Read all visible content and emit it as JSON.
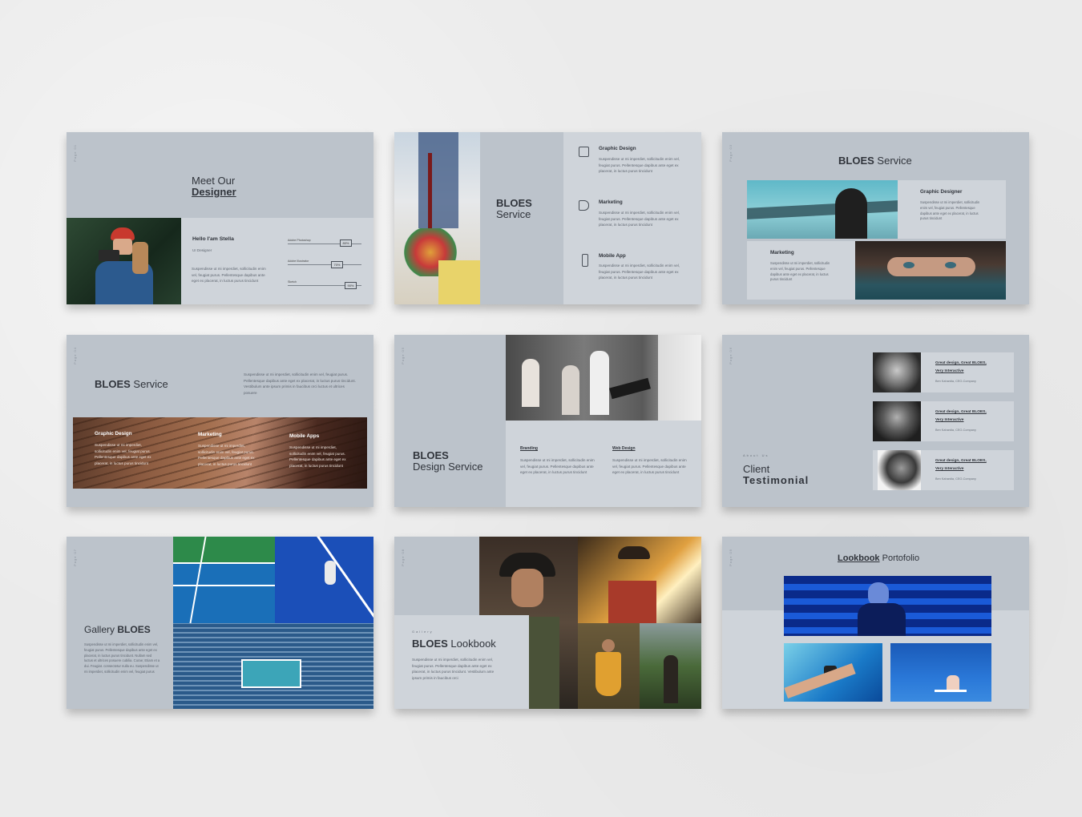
{
  "slides": {
    "s1": {
      "title_a": "Meet Our",
      "title_b": "Designer",
      "name": "Hello I'am Stella",
      "role": "UI Designer",
      "body": "Suspendisse ut mi imperdiet, sollicitudin enim vel, feugiat purus. Pellentesque dapibus ante eget ex placerat, in luctus purus tincidunt",
      "skills": [
        {
          "label": "Adobe Photoshop",
          "pct": "80%",
          "value": 0.8
        },
        {
          "label": "Adobe Illustrator",
          "pct": "70%",
          "value": 0.7
        },
        {
          "label": "Sketch",
          "pct": "90%",
          "value": 0.9
        }
      ]
    },
    "s2": {
      "title_a": "BLOES",
      "title_b": "Service",
      "items": [
        {
          "icon": "pencil-icon",
          "title": "Graphic Design"
        },
        {
          "icon": "megaphone-icon",
          "title": "Marketing"
        },
        {
          "icon": "phone-icon",
          "title": "Mobile App"
        }
      ],
      "body": "Suspendisse ut mi imperdiet, sollicitudin enim vel, feugiat purus. Pellentesque dapibus ante eget ex placerat, in luctus purus tincidunt"
    },
    "s3": {
      "title_a": "BLOES",
      "title_b": "Service",
      "c1": "Graphic Designer",
      "c2": "Marketing",
      "body": "Suspendisse ut mi imperdiet, sollicitudin enim vel, feugiat purus. Pellentesque dapibus ante eget ex placerat, in luctus purus tincidunt"
    },
    "s4": {
      "title_a": "BLOES",
      "title_b": "Service",
      "intro": "Suspendisse ut mi imperdiet, sollicitudin enim vel, feugiat purus. Pellentesque dapibus ante eget ex placerat, in luctus purus tincidunt. Vestibulum ante ipsum primis in faucibus orci luctus et ultrices posuere",
      "cols": [
        "Graphic Design",
        "Marketing",
        "Mobile Apps"
      ],
      "body": "Suspendisse ut mi imperdiet, sollicitudin enim vel, feugiat purus. Pellentesque dapibus ante eget ex placerat, in luctus purus tincidunt"
    },
    "s5": {
      "title_a": "BLOES",
      "title_b": "Design Service",
      "cols": [
        "Branding",
        "Web Design"
      ],
      "body": "Suspendisse ut mi imperdiet, sollicitudin enim vel, feugiat purus. Pellentesque dapibus ante eget ex placerat, in luctus purus tincidunt"
    },
    "s6": {
      "kicker": "About Us",
      "title_a": "Client",
      "title_b": "Testimonial",
      "quote_a": "Great design, Great BLOES,",
      "quote_b": "Very Interactive",
      "author": "Ben Kahardia, CEO-Company"
    },
    "s7": {
      "title_a": "Gallery",
      "title_b": "BLOES",
      "body": "Suspendisse ut mi imperdiet, sollicitudin enim vel, feugiat purus. Pellentesque dapibus ante eget ex placerat, in luctus purus tincidunt. Nullam sed luctus et ultrices posuere cubilia. Curae; Etiam et a dui. Feugiat. consectetur nulla eu. Suspendisse ut mi imperdiet, sollicitudin enim vel, feugiat purus"
    },
    "s8": {
      "kicker": "Gallery",
      "title_a": "BLOES",
      "title_b": "Lookbook",
      "body": "Suspendisse ut mi imperdiet, sollicitudin enim vel, feugiat purus. Pellentesque dapibus ante eget ex placerat, in luctus purus tincidunt. Vestibulum ante ipsum primis in faucibus orci"
    },
    "s9": {
      "title_a": "Lookbook",
      "title_b": "Portofolio"
    }
  },
  "colors": {
    "slide_bg": "#bcc3cb",
    "card_bg": "#cfd4da",
    "text": "#30343b"
  }
}
